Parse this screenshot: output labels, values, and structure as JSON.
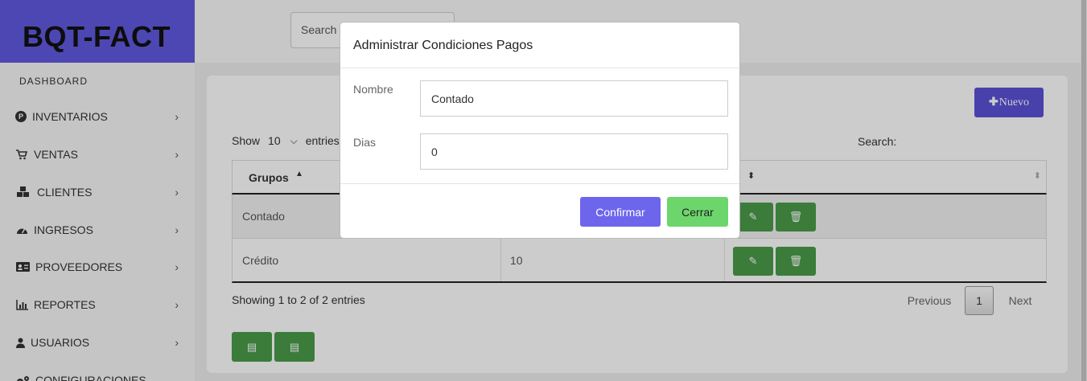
{
  "app": {
    "brand": "BQT-FACT"
  },
  "sidebar": {
    "dashboard": "DASHBOARD",
    "items": [
      {
        "label": "INVENTARIOS",
        "icon": "parking-circle-icon"
      },
      {
        "label": "VENTAS",
        "icon": "cart-icon"
      },
      {
        "label": "CLIENTES",
        "icon": "cubes-icon"
      },
      {
        "label": "INGRESOS",
        "icon": "dashboard-gauge-icon"
      },
      {
        "label": "PROVEEDORES",
        "icon": "id-card-icon"
      },
      {
        "label": "REPORTES",
        "icon": "bar-chart-icon"
      },
      {
        "label": "USUARIOS",
        "icon": "user-icon"
      },
      {
        "label": "CONFIGURACIONES",
        "icon": "gears-icon"
      }
    ]
  },
  "topbar": {
    "search_placeholder": "Search"
  },
  "main": {
    "new_button": "Nuevo",
    "show_label": "Show",
    "show_value": "10",
    "entries_label": "entries",
    "search_label": "Search:",
    "table": {
      "headers": [
        "Grupos",
        "",
        ""
      ],
      "rows": [
        {
          "name": "Contado",
          "dias": ""
        },
        {
          "name": "Crédito",
          "dias": "10"
        }
      ]
    },
    "info": "Showing 1 to 2 of 2 entries",
    "pagination": {
      "prev": "Previous",
      "current": "1",
      "next": "Next"
    }
  },
  "modal": {
    "title": "Administrar Condiciones Pagos",
    "fields": {
      "nombre_label": "Nombre",
      "nombre_value": "Contado",
      "dias_label": "Dias",
      "dias_value": "0"
    },
    "confirm": "Confirmar",
    "close": "Cerrar"
  },
  "colors": {
    "brand": "#6159e0",
    "primary": "#5a52d8",
    "confirm": "#6d66ec",
    "close": "#6cd66c",
    "action_green": "#4a9c4a"
  }
}
